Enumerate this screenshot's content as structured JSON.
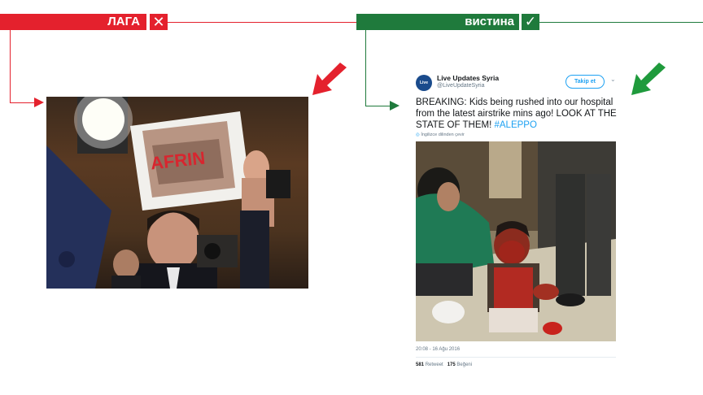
{
  "lie": {
    "label": "ЛАГА",
    "icon": "✕",
    "color": "#e4212d"
  },
  "truth": {
    "label": "вистина",
    "icon": "✓",
    "color": "#1f7a3c"
  },
  "left_photo": {
    "sign_text": "AFRIN"
  },
  "tweet": {
    "avatar_text": "Live Updates",
    "account_name": "Live Updates Syria",
    "handle": "@LiveUpdateSyria",
    "follow_label": "Takip et",
    "text_main": "BREAKING: Kids being rushed into our hospital from the latest airstrike mins ago! LOOK AT THE STATE OF THEM! ",
    "hashtag": "#ALEPPO",
    "translate": "İngilizce dilinden çevir",
    "timestamp": "20:08 - 16 Ağu 2016",
    "retweets_count": "581",
    "retweets_label": "Retweet",
    "likes_count": "175",
    "likes_label": "Beğeni"
  }
}
